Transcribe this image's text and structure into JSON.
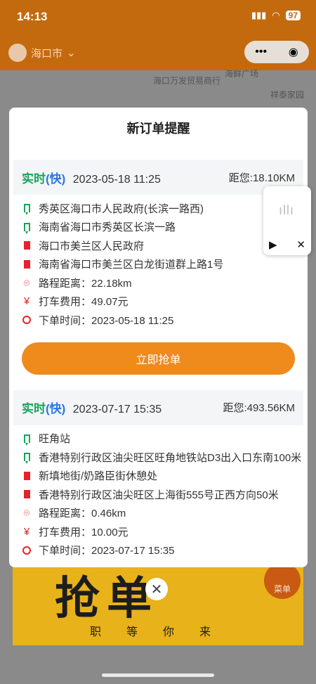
{
  "status_bar": {
    "time": "14:13",
    "battery": "97"
  },
  "header": {
    "city": "海口市"
  },
  "map_labels": [
    "海口万发贸易商行",
    "祥泰家园",
    "海鲜广场"
  ],
  "modal": {
    "title": "新订单提醒",
    "orders": [
      {
        "mode_prefix": "实时",
        "mode_type": "(快)",
        "datetime": "2023-05-18 11:25",
        "distance": "距您:18.10KM",
        "start_name": "秀英区海口市人民政府(长滨一路西)",
        "start_address": "海南省海口市秀英区长滨一路",
        "end_name": "海口市美兰区人民政府",
        "end_address": "海南省海口市美兰区白龙街道群上路1号",
        "route_distance": "路程距离：22.18km",
        "fare": "打车费用：49.07元",
        "order_time": "下单时间：2023-05-18 11:25",
        "button": "立即抢单"
      },
      {
        "mode_prefix": "实时",
        "mode_type": "(快)",
        "datetime": "2023-07-17 15:35",
        "distance": "距您:493.56KM",
        "start_name": "旺角站",
        "start_address": "香港特别行政区油尖旺区旺角地铁站D3出入口东南100米",
        "end_name": "新填地街/奶路臣街休憩处",
        "end_address": "香港特别行政区油尖旺区上海街555号正西方向50米",
        "route_distance": "路程距离：0.46km",
        "fare": "打车费用：10.00元",
        "order_time": "下单时间：2023-07-17 15:35"
      }
    ]
  },
  "banner": {
    "big_text": "抢单",
    "small_text": "职等你来"
  },
  "menu_button": "菜单",
  "colors": {
    "accent": "#ef8a1d",
    "green": "#19a35a",
    "blue": "#2878e6",
    "red": "#e8202a"
  }
}
